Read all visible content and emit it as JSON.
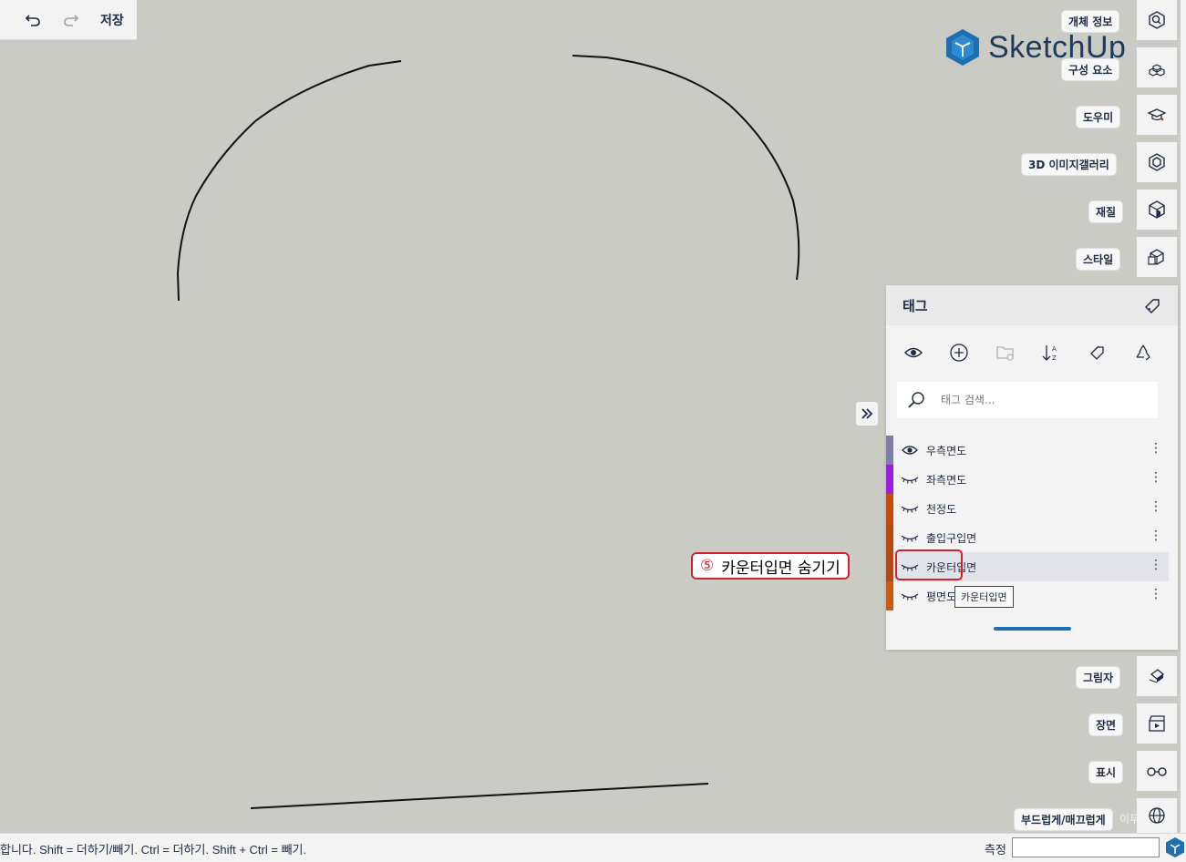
{
  "toolbar": {
    "save_label": "저장"
  },
  "logo": {
    "text": "SketchUp"
  },
  "right_rail": {
    "items": [
      {
        "label": "개체 정보",
        "icon": "entity-info-icon"
      },
      {
        "label": "구성 요소",
        "icon": "components-icon"
      },
      {
        "label": "도우미",
        "icon": "instructor-icon"
      },
      {
        "label": "3D 이미지갤러리",
        "icon": "3d-warehouse-icon"
      },
      {
        "label": "재질",
        "icon": "materials-icon"
      },
      {
        "label": "스타일",
        "icon": "styles-icon"
      },
      {
        "label": "그림자",
        "icon": "shadows-icon"
      },
      {
        "label": "장면",
        "icon": "scenes-icon"
      },
      {
        "label": "표시",
        "icon": "display-icon"
      },
      {
        "label": "부드럽게/매끄럽게",
        "icon": "soften-icon"
      }
    ]
  },
  "tags_panel": {
    "title": "태그",
    "search_placeholder": "태그 검색...",
    "tags": [
      {
        "name": "우측면도",
        "color": "#7d7da6",
        "visible": true
      },
      {
        "name": "좌측면도",
        "color": "#9b1fe0",
        "visible": false
      },
      {
        "name": "천정도",
        "color": "#c84b0b",
        "visible": false
      },
      {
        "name": "출입구입면",
        "color": "#b84a12",
        "visible": false
      },
      {
        "name": "카운터입면",
        "color": "#b14a1a",
        "visible": false
      },
      {
        "name": "평면도",
        "color": "#cc5a10",
        "visible": false
      }
    ],
    "tooltip": "카운터입면"
  },
  "annotation": {
    "number": "⑤",
    "text": "카운터입면 숨기기"
  },
  "status": {
    "hint": "합니다. Shift = 더하기/빼기. Ctrl = 더하기. Shift + Ctrl = 빼기.",
    "measure_label": "측정",
    "measure_value": "",
    "overlay_text": "이두"
  },
  "colors": {
    "accent": "#1a6fb5",
    "annotation_red": "#d4222a",
    "canvas": "#cbcbc5"
  }
}
